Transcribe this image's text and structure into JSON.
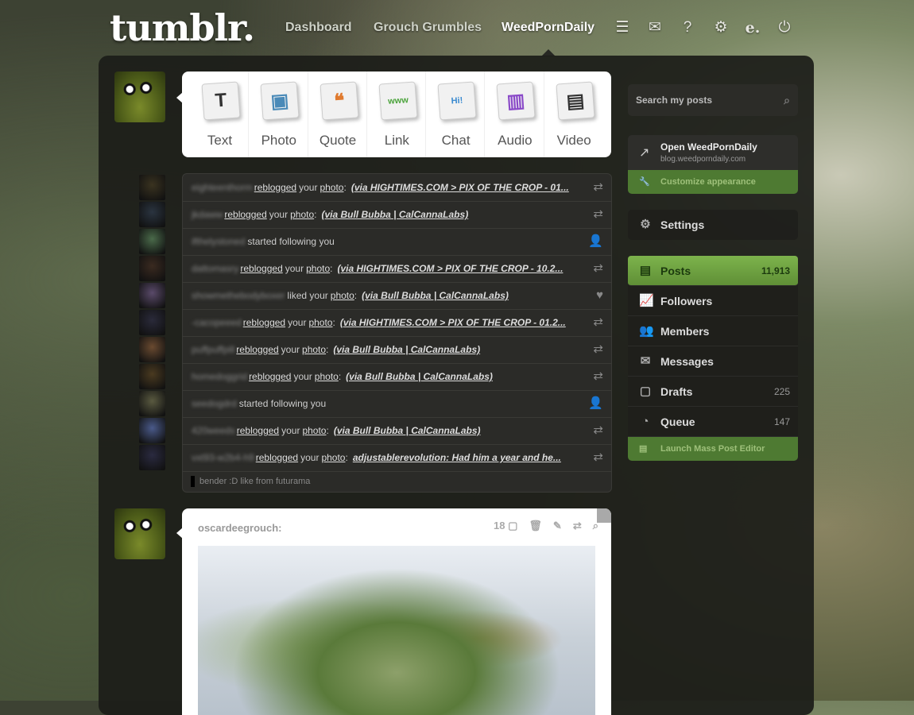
{
  "header": {
    "logo": "tumblr.",
    "nav": [
      "Dashboard",
      "Grouch Grumbles",
      "WeedPornDaily"
    ],
    "icons": [
      "list-icon",
      "mail-icon",
      "help-icon",
      "gear-icon",
      "e-icon",
      "power-icon"
    ]
  },
  "post_types": [
    {
      "label": "Text",
      "glyph": "T",
      "color": "#333"
    },
    {
      "label": "Photo",
      "glyph": "▣",
      "color": "#4a8ab8"
    },
    {
      "label": "Quote",
      "glyph": "❝",
      "color": "#e07a2e"
    },
    {
      "label": "Link",
      "glyph": "www",
      "color": "#4aa33a"
    },
    {
      "label": "Chat",
      "glyph": "Hi!",
      "color": "#3a8ad0"
    },
    {
      "label": "Audio",
      "glyph": "▥",
      "color": "#8a4ac8"
    },
    {
      "label": "Video",
      "glyph": "▤",
      "color": "#333"
    }
  ],
  "activity": [
    {
      "user": "eighteenthorm",
      "action": "reblogged",
      "mid": "your",
      "obj": "photo",
      "src": "(via HIGHTIMES.COM > PIX OF THE CROP - 01...",
      "icon": "⇄"
    },
    {
      "user": "jkdaww",
      "action": "reblogged",
      "mid": "your",
      "obj": "photo",
      "src": "(via Bull Bubba | CalCannaLabs)",
      "icon": "⇄"
    },
    {
      "user": "ifthelystoned",
      "action": "",
      "mid": "started following you",
      "obj": "",
      "src": "",
      "icon": "👤"
    },
    {
      "user": "dattomasry",
      "action": "reblogged",
      "mid": "your",
      "obj": "photo",
      "src": "(via HIGHTIMES.COM > PIX OF THE CROP - 10.2...",
      "icon": "⇄"
    },
    {
      "user": "showmethebodyboxer",
      "action": "",
      "mid": "liked your",
      "obj": "photo",
      "src": "(via Bull Bubba | CalCannaLabs)",
      "icon": "♥"
    },
    {
      "user": "-cacopeeed",
      "action": "reblogged",
      "mid": "your",
      "obj": "photo",
      "src": "(via HIGHTIMES.COM > PIX OF THE CROP - 01.2...",
      "icon": "⇄"
    },
    {
      "user": "puffpuffpill",
      "action": "reblogged",
      "mid": "your",
      "obj": "photo",
      "src": "(via Bull Bubba | CalCannaLabs)",
      "icon": "⇄"
    },
    {
      "user": "homedoggrid",
      "action": "reblogged",
      "mid": "your",
      "obj": "photo",
      "src": "(via Bull Bubba | CalCannaLabs)",
      "icon": "⇄"
    },
    {
      "user": "seedogdrd",
      "action": "",
      "mid": "started following you",
      "obj": "",
      "src": "",
      "icon": "👤"
    },
    {
      "user": "420weeds",
      "action": "reblogged",
      "mid": "your",
      "obj": "photo",
      "src": "(via Bull Bubba | CalCannaLabs)",
      "icon": "⇄"
    },
    {
      "user": "vxt93-w2b4-h9",
      "action": "reblogged",
      "mid": "your",
      "obj": "photo",
      "src": "adjustablerevolution: Had him a year and he...",
      "icon": "⇄"
    }
  ],
  "activity_reply": "bender :D like from futurama",
  "post": {
    "user": "oscardeegrouch:",
    "notes": "18",
    "controls": [
      "notes-icon",
      "delete-icon",
      "edit-icon",
      "reblog-icon",
      "search-icon"
    ]
  },
  "sidebar": {
    "search_placeholder": "Search my posts",
    "open_blog": "Open WeedPornDaily",
    "blog_url": "blog.weedporndaily.com",
    "customize": "Customize appearance",
    "settings": "Settings",
    "items": [
      {
        "label": "Posts",
        "count": "11,913",
        "icon": "▤",
        "active": true
      },
      {
        "label": "Followers",
        "count": "",
        "icon": "📈",
        "active": false
      },
      {
        "label": "Members",
        "count": "",
        "icon": "👥",
        "active": false
      },
      {
        "label": "Messages",
        "count": "",
        "icon": "✉",
        "active": false
      },
      {
        "label": "Drafts",
        "count": "225",
        "icon": "▢",
        "active": false
      },
      {
        "label": "Queue",
        "count": "147",
        "icon": "◔",
        "active": false
      }
    ],
    "mass_editor": "Launch Mass Post Editor"
  }
}
